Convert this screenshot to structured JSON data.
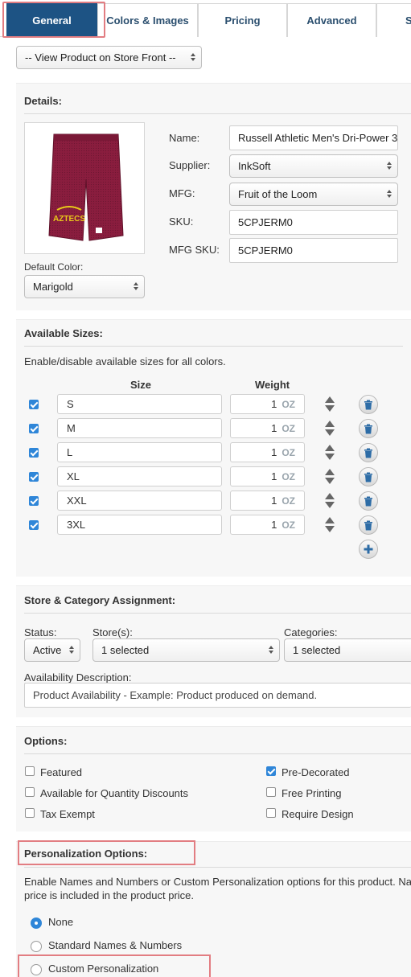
{
  "tabs": [
    {
      "label": "General"
    },
    {
      "label": "Colors & Images"
    },
    {
      "label": "Pricing"
    },
    {
      "label": "Advanced"
    },
    {
      "label": "S"
    }
  ],
  "view_store_select": "-- View Product on Store Front --",
  "details": {
    "title": "Details:",
    "name_label": "Name:",
    "name_value": "Russell Athletic Men's Dri-Power 3",
    "supplier_label": "Supplier:",
    "supplier_value": "InkSoft",
    "mfg_label": "MFG:",
    "mfg_value": "Fruit of the Loom",
    "sku_label": "SKU:",
    "sku_value": "5CPJERM0",
    "mfg_sku_label": "MFG SKU:",
    "mfg_sku_value": "5CPJERM0",
    "default_color_label": "Default Color:",
    "default_color_value": "Marigold",
    "image_text_line1": "AZTECS",
    "product_color": "#8a1d3e"
  },
  "sizes": {
    "title": "Available Sizes:",
    "description": "Enable/disable available sizes for all colors.",
    "size_header": "Size",
    "weight_header": "Weight",
    "rows": [
      {
        "size": "S",
        "weight": "1",
        "unit": "OZ",
        "checked": true
      },
      {
        "size": "M",
        "weight": "1",
        "unit": "OZ",
        "checked": true
      },
      {
        "size": "L",
        "weight": "1",
        "unit": "OZ",
        "checked": true
      },
      {
        "size": "XL",
        "weight": "1",
        "unit": "OZ",
        "checked": true
      },
      {
        "size": "XXL",
        "weight": "1",
        "unit": "OZ",
        "checked": true
      },
      {
        "size": "3XL",
        "weight": "1",
        "unit": "OZ",
        "checked": true
      }
    ]
  },
  "store_category": {
    "title": "Store & Category Assignment:",
    "status_label": "Status:",
    "status_value": "Active",
    "stores_label": "Store(s):",
    "stores_value": "1 selected",
    "categories_label": "Categories:",
    "categories_value": "1 selected",
    "availability_label": "Availability Description:",
    "availability_placeholder": "Product Availability - Example: Product produced on demand."
  },
  "options": {
    "title": "Options:",
    "items": [
      {
        "label": "Featured",
        "checked": false
      },
      {
        "label": "Pre-Decorated",
        "checked": true
      },
      {
        "label": "Available for Quantity Discounts",
        "checked": false
      },
      {
        "label": "Free Printing",
        "checked": false
      },
      {
        "label": "Tax Exempt",
        "checked": false
      },
      {
        "label": "Require Design",
        "checked": false
      }
    ]
  },
  "personalization": {
    "title": "Personalization Options:",
    "description_line1": "Enable Names and Numbers or Custom Personalization options for this product. Name",
    "description_line2": "price is included in the product price.",
    "radios": [
      {
        "label": "None",
        "checked": true
      },
      {
        "label": "Standard Names & Numbers",
        "checked": false
      },
      {
        "label": "Custom Personalization",
        "checked": false
      }
    ]
  },
  "colors": {
    "accent": "#1d5384",
    "highlight": "#e27d82",
    "checkbox": "#2f86d8"
  }
}
